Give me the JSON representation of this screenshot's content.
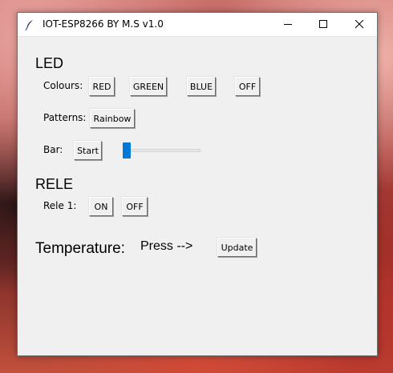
{
  "window": {
    "title": "IOT-ESP8266 BY M.S v1.0",
    "icons": {
      "app": "feather-icon",
      "minimize": "minimize-icon",
      "maximize": "maximize-icon",
      "close": "close-icon"
    }
  },
  "led": {
    "heading": "LED",
    "colours_label": "Colours:",
    "buttons": {
      "red": "RED",
      "green": "GREEN",
      "blue": "BLUE",
      "off": "OFF"
    },
    "patterns_label": "Patterns:",
    "rainbow": "Rainbow",
    "bar_label": "Bar:",
    "start": "Start",
    "slider_value": 0
  },
  "rele": {
    "heading": "RELE",
    "rele1_label": "Rele 1:",
    "on": "ON",
    "off": "OFF"
  },
  "temperature": {
    "label": "Temperature:",
    "value": "Press -->",
    "update": "Update"
  },
  "colors": {
    "slider_accent": "#0078d7",
    "window_bg": "#f0f0f0"
  }
}
